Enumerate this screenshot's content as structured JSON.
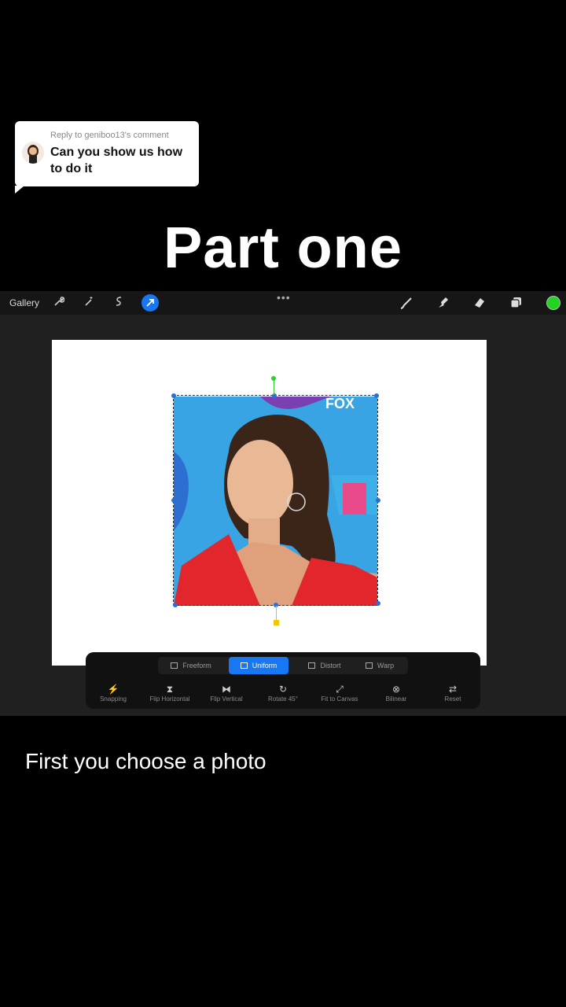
{
  "reply": {
    "meta": "Reply to geniboo13's comment",
    "message": "Can you show us how to do it"
  },
  "title": "Part one",
  "app": {
    "gallery_label": "Gallery",
    "toolbar_icons": [
      "wrench-icon",
      "magic-wand-icon",
      "selection-icon",
      "transform-arrow-icon",
      "brush-icon",
      "smudge-icon",
      "eraser-icon",
      "layers-icon"
    ],
    "accent_color": "#1877f2",
    "current_color": "#22d322",
    "photo_text": {
      "logo": "FOX"
    },
    "transform_modes": [
      {
        "label": "Freeform",
        "active": false
      },
      {
        "label": "Uniform",
        "active": true
      },
      {
        "label": "Distort",
        "active": false
      },
      {
        "label": "Warp",
        "active": false
      }
    ],
    "actions": [
      {
        "label": "Snapping",
        "icon": "⚡"
      },
      {
        "label": "Flip Horizontal",
        "icon": "⧗"
      },
      {
        "label": "Flip Vertical",
        "icon": "⧓"
      },
      {
        "label": "Rotate 45°",
        "icon": "↻"
      },
      {
        "label": "Fit to Canvas",
        "icon": "⤢"
      },
      {
        "label": "Bilinear",
        "icon": "⊗"
      },
      {
        "label": "Reset",
        "icon": "⇄"
      }
    ]
  },
  "caption": "First you choose a photo"
}
